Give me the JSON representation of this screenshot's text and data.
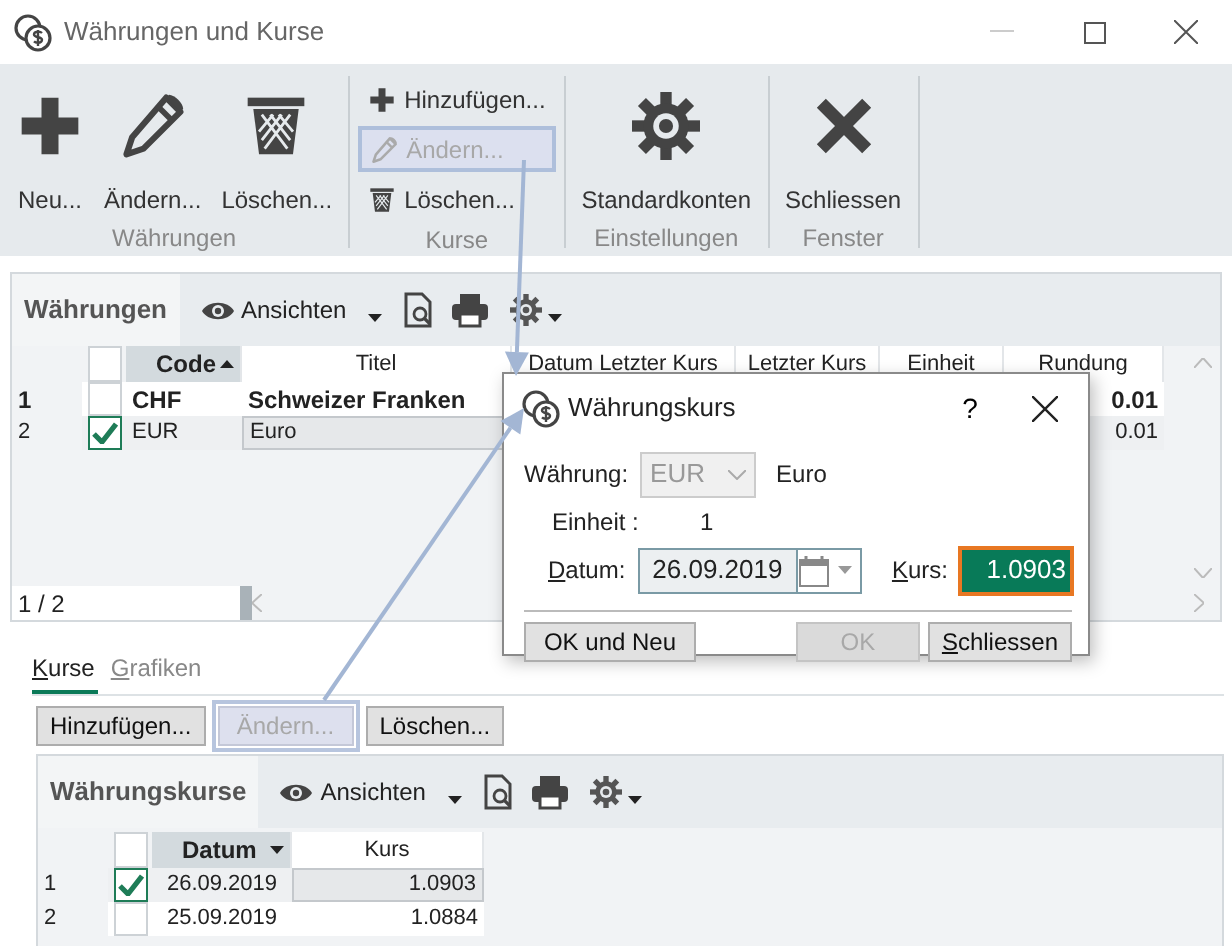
{
  "window": {
    "title": "Währungen und Kurse"
  },
  "ribbon": [
    {
      "label": "Währungen",
      "kind": "large",
      "items": [
        {
          "kind": "add",
          "label": "Neu...",
          "disabled": false,
          "highlighted": false
        },
        {
          "kind": "edit",
          "label": "Ändern...",
          "disabled": false,
          "highlighted": false
        },
        {
          "kind": "delete",
          "label": "Löschen...",
          "disabled": false,
          "highlighted": false
        }
      ]
    },
    {
      "label": "Kurse",
      "kind": "small",
      "items": [
        {
          "kind": "add",
          "label": "Hinzufügen...",
          "disabled": false,
          "highlighted": false
        },
        {
          "kind": "edit",
          "label": "Ändern...",
          "disabled": true,
          "highlighted": true
        },
        {
          "kind": "delete",
          "label": "Löschen...",
          "disabled": false,
          "highlighted": false
        }
      ]
    },
    {
      "label": "Einstellungen",
      "kind": "large",
      "items": [
        {
          "kind": "settings",
          "label": "Standardkonten",
          "disabled": false,
          "highlighted": false
        }
      ]
    },
    {
      "label": "Fenster",
      "kind": "large",
      "items": [
        {
          "kind": "close",
          "label": "Schliessen",
          "disabled": false,
          "highlighted": false
        }
      ]
    }
  ],
  "currencies": {
    "title": "Währungen",
    "views": "Ansichten",
    "columns": [
      {
        "label": "Code",
        "sorted": true,
        "descending": false
      },
      {
        "label": "Titel",
        "sorted": false
      },
      {
        "label": "Datum Letzter Kurs",
        "sorted": false
      },
      {
        "label": "Letzter Kurs",
        "sorted": false
      },
      {
        "label": "Einheit",
        "sorted": false
      },
      {
        "label": "Rundung",
        "sorted": false
      }
    ],
    "rows": [
      {
        "number": "1",
        "checked": false,
        "selected": false,
        "bold": true,
        "code": "CHF",
        "title": "Schweizer Franken",
        "rounding": "0.01"
      },
      {
        "number": "2",
        "checked": true,
        "selected": true,
        "bold": false,
        "code": "EUR",
        "title": "Euro",
        "rounding": "0.01"
      }
    ],
    "position": "1 / 2"
  },
  "dialog": {
    "title": "Währungskurs",
    "help": "?",
    "currency_label": "Währung:",
    "currency_value": "EUR",
    "currency_disabled": true,
    "currency_name": "Euro",
    "unit_label": "Einheit :",
    "unit_value": "1",
    "date_label": "Datum:",
    "date_value": "26.09.2019",
    "rate_label": "Kurs:",
    "rate_value": "1.0903",
    "buttons": [
      {
        "label": "OK und Neu",
        "disabled": false,
        "underline_first": false
      },
      {
        "label": "OK",
        "disabled": true,
        "underline_first": false
      },
      {
        "label": "Schliessen",
        "disabled": false,
        "underline_first": true
      }
    ]
  },
  "tabs": [
    {
      "label": "Kurse",
      "selected": true
    },
    {
      "label": "Grafiken",
      "selected": false
    }
  ],
  "rate_buttons": [
    {
      "label": "Hinzufügen...",
      "disabled": false,
      "highlighted": false
    },
    {
      "label": "Ändern...",
      "disabled": true,
      "highlighted": true
    },
    {
      "label": "Löschen...",
      "disabled": false,
      "highlighted": false
    }
  ],
  "rates": {
    "title": "Währungskurse",
    "views": "Ansichten",
    "columns": [
      {
        "label": "Datum",
        "sorted": true,
        "descending": true
      },
      {
        "label": "Kurs",
        "sorted": false
      }
    ],
    "rows": [
      {
        "number": "1",
        "checked": true,
        "selected": true,
        "date": "26.09.2019",
        "rate": "1.0903"
      },
      {
        "number": "2",
        "checked": false,
        "selected": false,
        "date": "25.09.2019",
        "rate": "1.0884"
      }
    ]
  }
}
